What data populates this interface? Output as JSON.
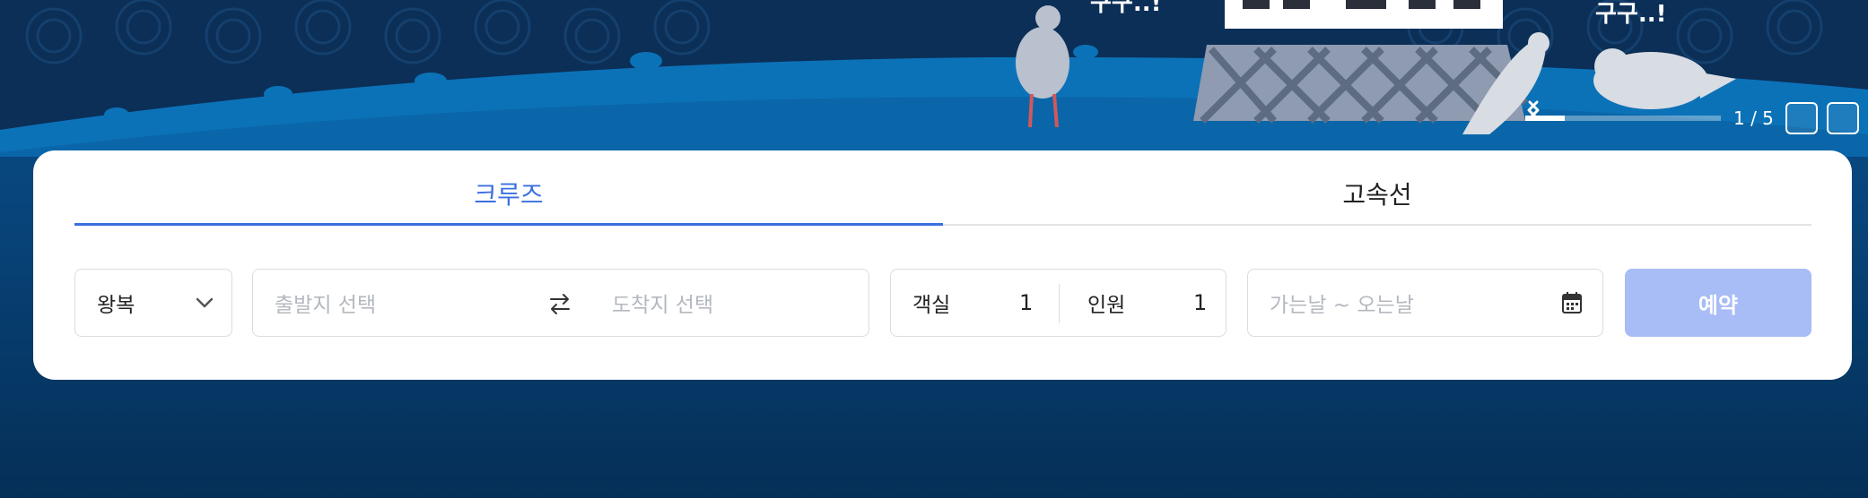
{
  "hero": {
    "bubble_left": "구구..!",
    "bubble_right": "구구..!",
    "carousel": {
      "current": 1,
      "total": 5,
      "counter_text": "1 / 5",
      "progress_fraction": 0.2,
      "prev_icon": "chevron-left-icon",
      "next_icon": "chevron-right-icon"
    }
  },
  "tabs": [
    {
      "label": "크루즈",
      "active": true
    },
    {
      "label": "고속선",
      "active": false
    }
  ],
  "search": {
    "trip_type": "왕복",
    "trip_icon": "chevron-down-icon",
    "departure_placeholder": "출발지 선택",
    "swap_icon": "swap-arrows-icon",
    "arrival_placeholder": "도착지 선택",
    "cabin_label": "객실",
    "cabin_count": "1",
    "people_label": "인원",
    "people_count": "1",
    "date_placeholder": "가는날 ~ 오는날",
    "date_icon": "calendar-icon",
    "book_label": "예약"
  },
  "colors": {
    "accent": "#3b6fe0",
    "book_button": "#a8bcf5",
    "background": "#0a4a86"
  }
}
